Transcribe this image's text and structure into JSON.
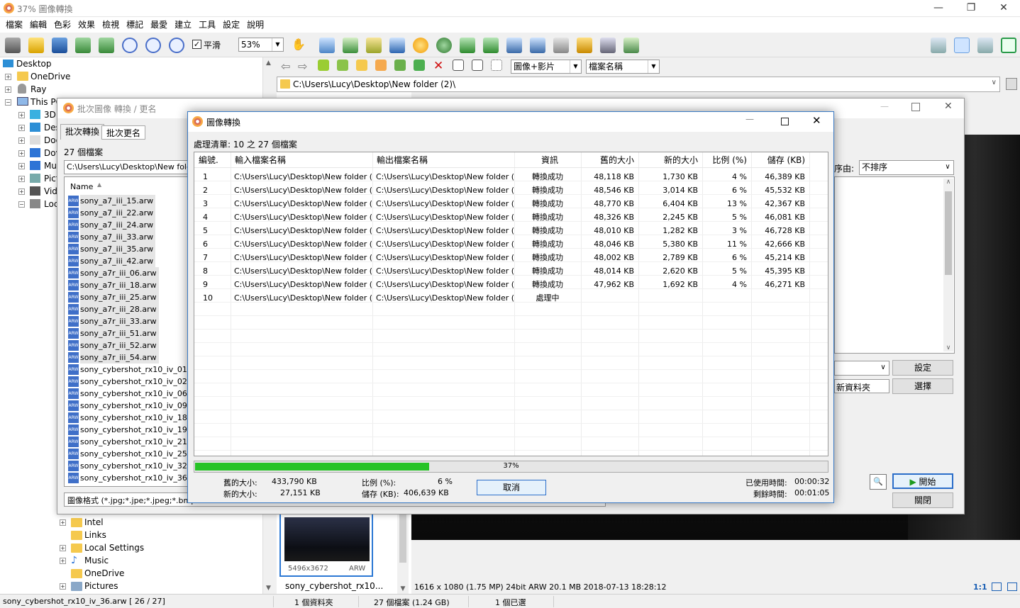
{
  "window": {
    "title": "37% 圖像轉換",
    "minimize": "—",
    "maximize": "❐",
    "close": "✕"
  },
  "menu": [
    "檔案",
    "編輯",
    "色彩",
    "效果",
    "檢視",
    "標記",
    "最愛",
    "建立",
    "工具",
    "設定",
    "說明"
  ],
  "toolbar": {
    "smooth_label": "平滑",
    "smooth_checked": true,
    "zoom": "53%"
  },
  "tree": {
    "items": [
      "Desktop",
      "OneDrive",
      "Ray",
      "This PC",
      "3D",
      "Des",
      "Doc",
      "Dov",
      "Mu",
      "Pict",
      "Vid",
      "Loc"
    ],
    "lower_items": [
      "Intel",
      "Links",
      "Local Settings",
      "Music",
      "OneDrive",
      "Pictures"
    ]
  },
  "browser": {
    "view_mode": "圖像+影片",
    "sort_field": "檔案名稱",
    "address": "C:\\Users\\Lucy\\Desktop\\New folder (2)\\",
    "thumb_caption": "sony_cybershot_rx10...",
    "thumb_size": "5496x3672",
    "thumb_format": "ARW"
  },
  "batch": {
    "title": "批次圖像 轉換 / 更名",
    "tab_convert": "批次轉換",
    "tab_rename": "批次更名",
    "count": "27 個檔案",
    "path": "C:\\Users\\Lucy\\Desktop\\New folder",
    "name_header": "Name",
    "files": [
      "sony_a7_iii_15.arw",
      "sony_a7_iii_22.arw",
      "sony_a7_iii_24.arw",
      "sony_a7_iii_33.arw",
      "sony_a7_iii_35.arw",
      "sony_a7_iii_42.arw",
      "sony_a7r_iii_06.arw",
      "sony_a7r_iii_18.arw",
      "sony_a7r_iii_25.arw",
      "sony_a7r_iii_28.arw",
      "sony_a7r_iii_33.arw",
      "sony_a7r_iii_51.arw",
      "sony_a7r_iii_52.arw",
      "sony_a7r_iii_54.arw",
      "sony_cybershot_rx10_iv_01.ar",
      "sony_cybershot_rx10_iv_02.ar",
      "sony_cybershot_rx10_iv_06.ar",
      "sony_cybershot_rx10_iv_09.ar",
      "sony_cybershot_rx10_iv_18.ar",
      "sony_cybershot_rx10_iv_19.ar",
      "sony_cybershot_rx10_iv_21.ar",
      "sony_cybershot_rx10_iv_25.ar",
      "sony_cybershot_rx10_iv_32.ar",
      "sony_cybershot_rx10_iv_36.ar"
    ],
    "file_icon": "ARW",
    "filter": "圖像格式 (*.jpg;*.jpe;*.jpeg;*.bmp",
    "sort_label": "序由:",
    "sort_value": "不排序",
    "settings_btn": "設定",
    "new_folder": "新資料夾",
    "choose_btn": "選擇",
    "start_btn": "開始",
    "close_btn": "關閉"
  },
  "convert": {
    "title": "圖像轉換",
    "queue": "處理清單: 10 之 27 個檔案",
    "headers": [
      "編號.",
      "輸入檔案名稱",
      "輸出檔案名稱",
      "資訊",
      "舊的大小",
      "新的大小",
      "比例 (%)",
      "儲存 (KB)"
    ],
    "rows": [
      [
        "1",
        "C:\\Users\\Lucy\\Desktop\\New folder (...",
        "C:\\Users\\Lucy\\Desktop\\New folder (...",
        "轉換成功",
        "48,118 KB",
        "1,730 KB",
        "4 %",
        "46,389 KB"
      ],
      [
        "2",
        "C:\\Users\\Lucy\\Desktop\\New folder (...",
        "C:\\Users\\Lucy\\Desktop\\New folder (...",
        "轉換成功",
        "48,546 KB",
        "3,014 KB",
        "6 %",
        "45,532 KB"
      ],
      [
        "3",
        "C:\\Users\\Lucy\\Desktop\\New folder (...",
        "C:\\Users\\Lucy\\Desktop\\New folder (...",
        "轉換成功",
        "48,770 KB",
        "6,404 KB",
        "13 %",
        "42,367 KB"
      ],
      [
        "4",
        "C:\\Users\\Lucy\\Desktop\\New folder (...",
        "C:\\Users\\Lucy\\Desktop\\New folder (...",
        "轉換成功",
        "48,326 KB",
        "2,245 KB",
        "5 %",
        "46,081 KB"
      ],
      [
        "5",
        "C:\\Users\\Lucy\\Desktop\\New folder (...",
        "C:\\Users\\Lucy\\Desktop\\New folder (...",
        "轉換成功",
        "48,010 KB",
        "1,282 KB",
        "3 %",
        "46,728 KB"
      ],
      [
        "6",
        "C:\\Users\\Lucy\\Desktop\\New folder (...",
        "C:\\Users\\Lucy\\Desktop\\New folder (...",
        "轉換成功",
        "48,046 KB",
        "5,380 KB",
        "11 %",
        "42,666 KB"
      ],
      [
        "7",
        "C:\\Users\\Lucy\\Desktop\\New folder (...",
        "C:\\Users\\Lucy\\Desktop\\New folder (...",
        "轉換成功",
        "48,002 KB",
        "2,789 KB",
        "6 %",
        "45,214 KB"
      ],
      [
        "8",
        "C:\\Users\\Lucy\\Desktop\\New folder (...",
        "C:\\Users\\Lucy\\Desktop\\New folder (...",
        "轉換成功",
        "48,014 KB",
        "2,620 KB",
        "5 %",
        "45,395 KB"
      ],
      [
        "9",
        "C:\\Users\\Lucy\\Desktop\\New folder (...",
        "C:\\Users\\Lucy\\Desktop\\New folder (...",
        "轉換成功",
        "47,962 KB",
        "1,692 KB",
        "4 %",
        "46,271 KB"
      ],
      [
        "10",
        "C:\\Users\\Lucy\\Desktop\\New folder (...",
        "C:\\Users\\Lucy\\Desktop\\New folder (...",
        "處理中",
        "",
        "",
        "",
        ""
      ]
    ],
    "progress_percent": 37,
    "progress_text": "37%",
    "old_size_label": "舊的大小:",
    "old_size": "433,790 KB",
    "new_size_label": "新的大小:",
    "new_size": "27,151 KB",
    "ratio_label": "比例 (%):",
    "ratio": "6 %",
    "saved_label": "儲存 (KB):",
    "saved": "406,639 KB",
    "cancel_btn": "取消",
    "elapsed_label": "已使用時間:",
    "elapsed": "00:00:32",
    "remaining_label": "剩餘時間:",
    "remaining": "00:01:05",
    "accent": "#27c327"
  },
  "statusbar": {
    "file": "sony_cybershot_rx10_iv_36.arw [ 26 / 27]",
    "folders": "1 個資料夾",
    "files": "27 個檔案 (1.24 GB)",
    "selected": "1 個已選",
    "image_info": "1616 x 1080 (1.75 MP)  24bit  ARW   20.1 MB   2018-07-13 18:28:12",
    "zoom_ratio": "1:1"
  }
}
